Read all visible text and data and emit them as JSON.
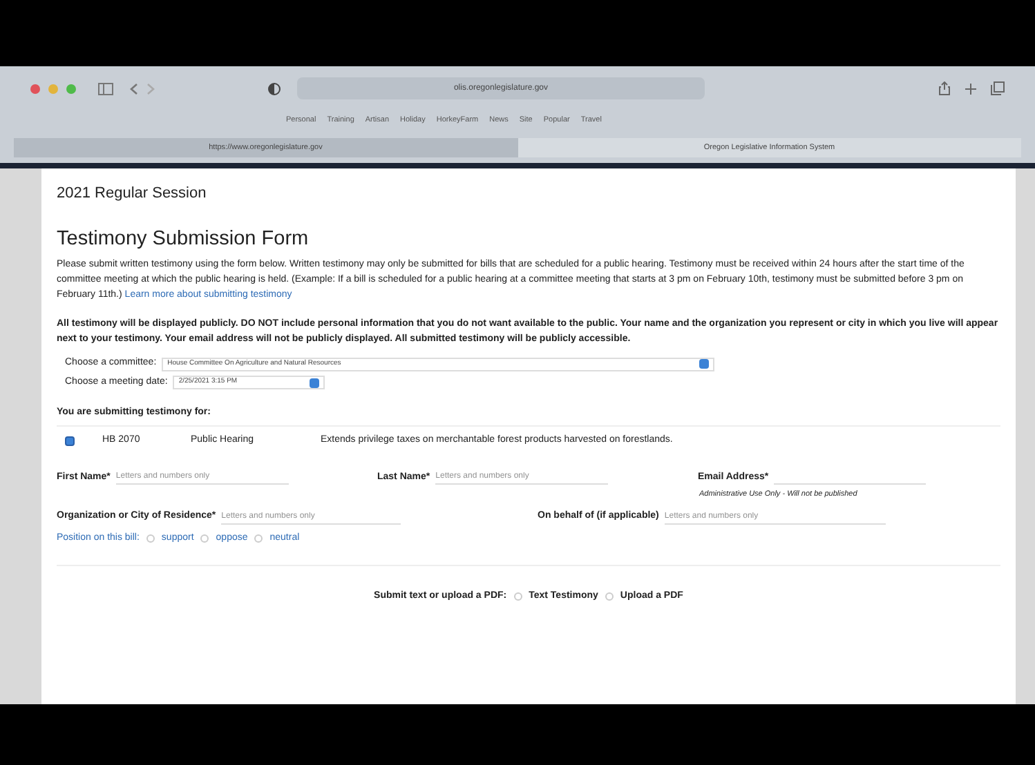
{
  "browser": {
    "url": "olis.oregonlegislature.gov",
    "bookmarks": [
      "Personal",
      "Training",
      "Artisan",
      "Holiday",
      "HorkeyFarm",
      "News",
      "Site",
      "Popular",
      "Travel"
    ],
    "tabs": [
      {
        "title": "https://www.oregonlegislature.gov",
        "selected": false
      },
      {
        "title": "Oregon Legislative Information System",
        "selected": true
      }
    ]
  },
  "session": "2021 Regular Session",
  "title": "Testimony Submission Form",
  "intro": "Please submit written testimony using the form below. Written testimony may only be submitted for bills that are scheduled for a public hearing. Testimony must be received within 24 hours after the start time of the committee meeting at which the public hearing is held. (Example: If a bill is scheduled for a public hearing at a committee meeting that starts at 3 pm on February 10th, testimony must be submitted before 3 pm on February 11th.)",
  "intro_link": "Learn more about submitting testimony",
  "notice": "All testimony will be displayed publicly. DO NOT include personal information that you do not want available to the public. Your name and the organization you represent or city in which you live will appear next to your testimony. Your email address will not be publicly displayed. All submitted testimony will be publicly accessible.",
  "selects": [
    {
      "label": "Choose a committee:",
      "value": "House Committee On Agriculture and Natural Resources"
    },
    {
      "label": "Choose a meeting date:",
      "value": "2/25/2021 3:15 PM"
    }
  ],
  "bills_heading": "You are submitting testimony for:",
  "bills": [
    {
      "checked": true,
      "number": "HB 2070",
      "type": "Public Hearing",
      "summary": "Extends privilege taxes on merchantable forest products harvested on forestlands."
    }
  ],
  "name_fields": [
    {
      "label": "First Name*",
      "placeholder": "Letters and numbers only"
    },
    {
      "label": "Last Name*",
      "placeholder": "Letters and numbers only"
    },
    {
      "label": "Email Address*",
      "note": "Administrative Use Only - Will not be published"
    }
  ],
  "org_fields": [
    {
      "label": "Organization or City of Residence*",
      "placeholder": "Letters and numbers only"
    },
    {
      "label": "On behalf of (if applicable)",
      "placeholder": "Letters and numbers only"
    }
  ],
  "position": {
    "label": "Position on this bill:",
    "options": [
      {
        "label": "support",
        "selected": false
      },
      {
        "label": "oppose",
        "selected": false
      },
      {
        "label": "neutral",
        "selected": false
      }
    ]
  },
  "submit": {
    "label": "Submit text or upload a PDF:",
    "options": [
      {
        "label": "Text Testimony",
        "selected": false
      },
      {
        "label": "Upload a PDF",
        "selected": false
      }
    ]
  }
}
